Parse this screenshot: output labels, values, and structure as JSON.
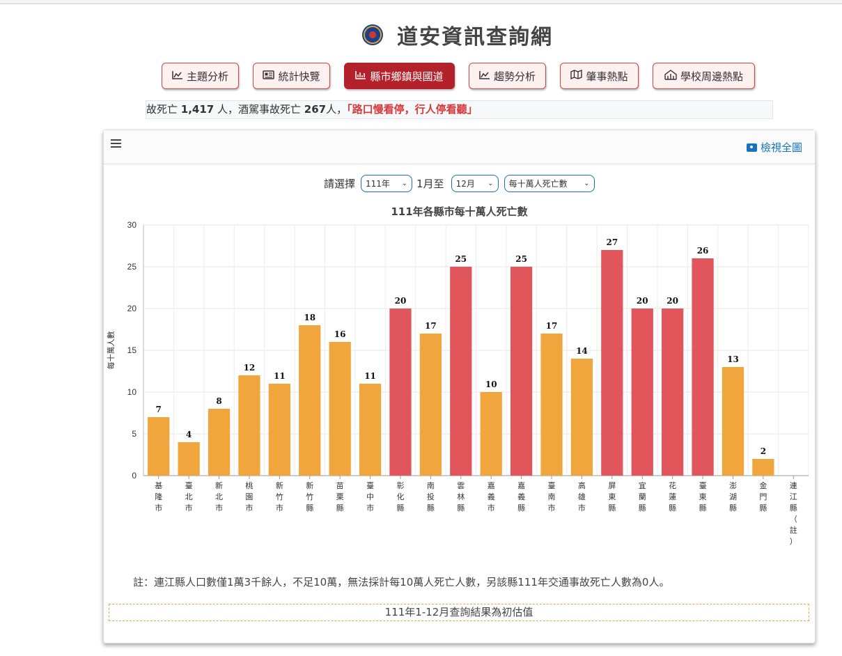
{
  "site": {
    "title": "道安資訊查詢網"
  },
  "nav": [
    {
      "label": "主題分析",
      "icon": "line-chart-icon",
      "active": false
    },
    {
      "label": "統計快覽",
      "icon": "newspaper-icon",
      "active": false
    },
    {
      "label": "縣市鄉鎮與國道",
      "icon": "bar-chart-icon",
      "active": true
    },
    {
      "label": "趨勢分析",
      "icon": "line-chart-icon",
      "active": false
    },
    {
      "label": "肇事熱點",
      "icon": "map-icon",
      "active": false
    },
    {
      "label": "學校周邊熱點",
      "icon": "school-icon",
      "active": false
    }
  ],
  "ticker": {
    "prefix": "故死亡 ",
    "deaths": "1,417",
    "mid1": " 人，酒駕事故死亡 ",
    "dui": "267",
    "mid2": "人，",
    "slogan": "「路口慢看停，行人停看聽」"
  },
  "toolbar": {
    "fullview_label": "檢視全圖"
  },
  "filters": {
    "prompt": "請選擇",
    "year": "111年",
    "month_from": "1月至",
    "month_to": "12月",
    "metric": "每十萬人死亡數"
  },
  "note": "註：連江縣人口數僅1萬3千餘人，不足10萬，無法採計每10萬人死亡人數，另該縣111年交通事故死亡人數為0人。",
  "footer": "111年1-12月查詢結果為初估值",
  "colors": {
    "accent": "#b3222b",
    "bar_orange": "#f0a63c",
    "bar_red": "#e0565b",
    "link": "#1673c2"
  },
  "chart_data": {
    "type": "bar",
    "title": "111年各縣市每十萬人死亡數",
    "ylabel": "每十萬人數",
    "ylim": [
      0,
      30
    ],
    "yticks": [
      0,
      5,
      10,
      15,
      20,
      25,
      30
    ],
    "categories": [
      "基隆市",
      "臺北市",
      "新北市",
      "桃園市",
      "新竹市",
      "新竹縣",
      "苗栗縣",
      "臺中市",
      "彰化縣",
      "南投縣",
      "雲林縣",
      "嘉義市",
      "嘉義縣",
      "臺南市",
      "高雄市",
      "屏東縣",
      "宜蘭縣",
      "花蓮縣",
      "臺東縣",
      "澎湖縣",
      "金門縣",
      "連江縣（註）"
    ],
    "values": [
      7,
      4,
      8,
      12,
      11,
      18,
      16,
      11,
      20,
      17,
      25,
      10,
      25,
      17,
      14,
      27,
      20,
      20,
      26,
      13,
      2,
      null
    ],
    "bar_colors": [
      "orange",
      "orange",
      "orange",
      "orange",
      "orange",
      "orange",
      "orange",
      "orange",
      "red",
      "orange",
      "red",
      "orange",
      "red",
      "orange",
      "orange",
      "red",
      "red",
      "red",
      "red",
      "orange",
      "orange",
      "none"
    ],
    "grid": true,
    "legend": "none"
  }
}
